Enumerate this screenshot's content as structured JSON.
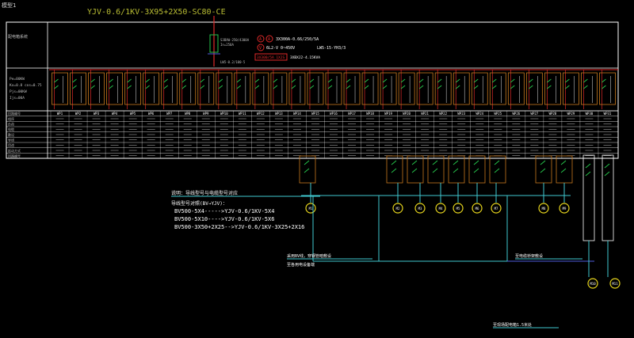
{
  "window": {
    "tab_title": "模型1"
  },
  "cable_header": "YJV-0.6/1KV-3X95+2X50-SC80-CE",
  "panel_label": "配电箱系统",
  "incoming": {
    "breaker": "S3BXW-250/4300A",
    "breaker_sub": "In=250A",
    "earth_label": "LW5-0.2/100·5",
    "meter_ammeter": "3X300A-0.66/250/5A",
    "meter_voltmeter": "6L2-V 0~450V",
    "meter_switch": "LW5-15-YH3/3",
    "ct": "3X300/5A 1XJS",
    "ct_note": "3XBXJ2-4.15KVA"
  },
  "left_specs": [
    "Pe=00KW",
    "Kx=0.8 cos=0.75",
    "Pjs=00KW",
    "Ijs=00A"
  ],
  "table_row_labels": [
    "回路编号",
    "相序",
    "负荷",
    "电缆",
    "敷设",
    "导线",
    "用途",
    "起动方式",
    "回路编号"
  ],
  "circuits": [
    "WP1",
    "WP2",
    "WP3",
    "WP4",
    "WP5",
    "WP6",
    "WP7",
    "WP8",
    "WP9",
    "WP10",
    "WP11",
    "WP12",
    "WP13",
    "WP14",
    "WP15",
    "WP16",
    "WP17",
    "WP18",
    "WP19",
    "WP20",
    "WP21",
    "WP22",
    "WP23",
    "WP24",
    "WP25",
    "WP26",
    "WP27",
    "WP28",
    "WP29",
    "WP30",
    "WP31"
  ],
  "notes": {
    "title": "说明：导线型号与电缆型号对应",
    "subtitle": "导线型号对照(BV→YJV)：",
    "lines": [
      "BV500-5X4----->YJV-0.6/1KV-5X4",
      "BV500-5X10---->YJV-0.6/1KV-5X6",
      "BV500-3X50+2X25-->YJV-0.6/1KV-3X25+2X16"
    ]
  },
  "bottom_notes": {
    "left_line1": "采用BV线，穿钢管暗敷设",
    "left_line2": "至各用电设备端",
    "right_upper": "至电缆桥架敷设",
    "right_lower": "至现场配电箱1.5米处"
  },
  "motors": [
    "M1",
    "M2",
    "M3",
    "M4",
    "M5",
    "M6",
    "M7",
    "M8",
    "M9",
    "M10",
    "M11"
  ],
  "colors": {
    "background": "#000000",
    "frame": "#ffffff",
    "heading": "#b9bd33",
    "cable_cyan": "#40c8d0",
    "breaker_green": "#25c24a",
    "meter_red": "#e02929",
    "motor_yellow": "#e8d61d",
    "box_orange": "#c97a1f",
    "blue_bus": "#4f5bdb",
    "label_gray": "#bfbfbf"
  }
}
